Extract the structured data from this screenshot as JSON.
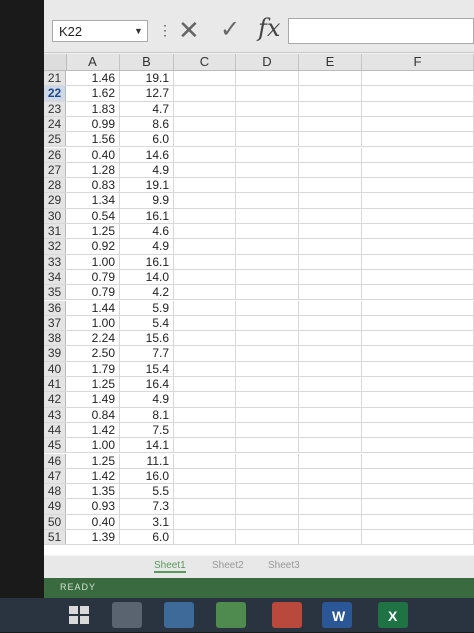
{
  "formula_bar": {
    "name_box": "K22",
    "name_box_arrow_icon": "chevron-down-icon",
    "dots": "⋮",
    "cancel_symbol": "✕",
    "enter_symbol": "✓",
    "fx_label": "fx",
    "formula_value": ""
  },
  "columns": [
    "A",
    "B",
    "C",
    "D",
    "E",
    "F"
  ],
  "active_row": "22",
  "rows": [
    {
      "n": "21",
      "a": "1.46",
      "b": "19.1"
    },
    {
      "n": "22",
      "a": "1.62",
      "b": "12.7"
    },
    {
      "n": "23",
      "a": "1.83",
      "b": "4.7"
    },
    {
      "n": "24",
      "a": "0.99",
      "b": "8.6"
    },
    {
      "n": "25",
      "a": "1.56",
      "b": "6.0"
    },
    {
      "n": "26",
      "a": "0.40",
      "b": "14.6"
    },
    {
      "n": "27",
      "a": "1.28",
      "b": "4.9"
    },
    {
      "n": "28",
      "a": "0.83",
      "b": "19.1"
    },
    {
      "n": "29",
      "a": "1.34",
      "b": "9.9"
    },
    {
      "n": "30",
      "a": "0.54",
      "b": "16.1"
    },
    {
      "n": "31",
      "a": "1.25",
      "b": "4.6"
    },
    {
      "n": "32",
      "a": "0.92",
      "b": "4.9"
    },
    {
      "n": "33",
      "a": "1.00",
      "b": "16.1"
    },
    {
      "n": "34",
      "a": "0.79",
      "b": "14.0"
    },
    {
      "n": "35",
      "a": "0.79",
      "b": "4.2"
    },
    {
      "n": "36",
      "a": "1.44",
      "b": "5.9"
    },
    {
      "n": "37",
      "a": "1.00",
      "b": "5.4"
    },
    {
      "n": "38",
      "a": "2.24",
      "b": "15.6"
    },
    {
      "n": "39",
      "a": "2.50",
      "b": "7.7"
    },
    {
      "n": "40",
      "a": "1.79",
      "b": "15.4"
    },
    {
      "n": "41",
      "a": "1.25",
      "b": "16.4"
    },
    {
      "n": "42",
      "a": "1.49",
      "b": "4.9"
    },
    {
      "n": "43",
      "a": "0.84",
      "b": "8.1"
    },
    {
      "n": "44",
      "a": "1.42",
      "b": "7.5"
    },
    {
      "n": "45",
      "a": "1.00",
      "b": "14.1"
    },
    {
      "n": "46",
      "a": "1.25",
      "b": "11.1"
    },
    {
      "n": "47",
      "a": "1.42",
      "b": "16.0"
    },
    {
      "n": "48",
      "a": "1.35",
      "b": "5.5"
    },
    {
      "n": "49",
      "a": "0.93",
      "b": "7.3"
    },
    {
      "n": "50",
      "a": "0.40",
      "b": "3.1"
    },
    {
      "n": "51",
      "a": "1.39",
      "b": "6.0"
    }
  ],
  "sheet_tabs": [
    "Sheet1",
    "Sheet2",
    "Sheet3"
  ],
  "active_sheet": "Sheet1",
  "status": "READY",
  "taskbar": {
    "word_glyph": "W",
    "excel_glyph": "X"
  },
  "colors": {
    "status_bar": "#3a6a3f",
    "active_row_header": "#cfd8e6",
    "taskbar": "#2a3340"
  }
}
